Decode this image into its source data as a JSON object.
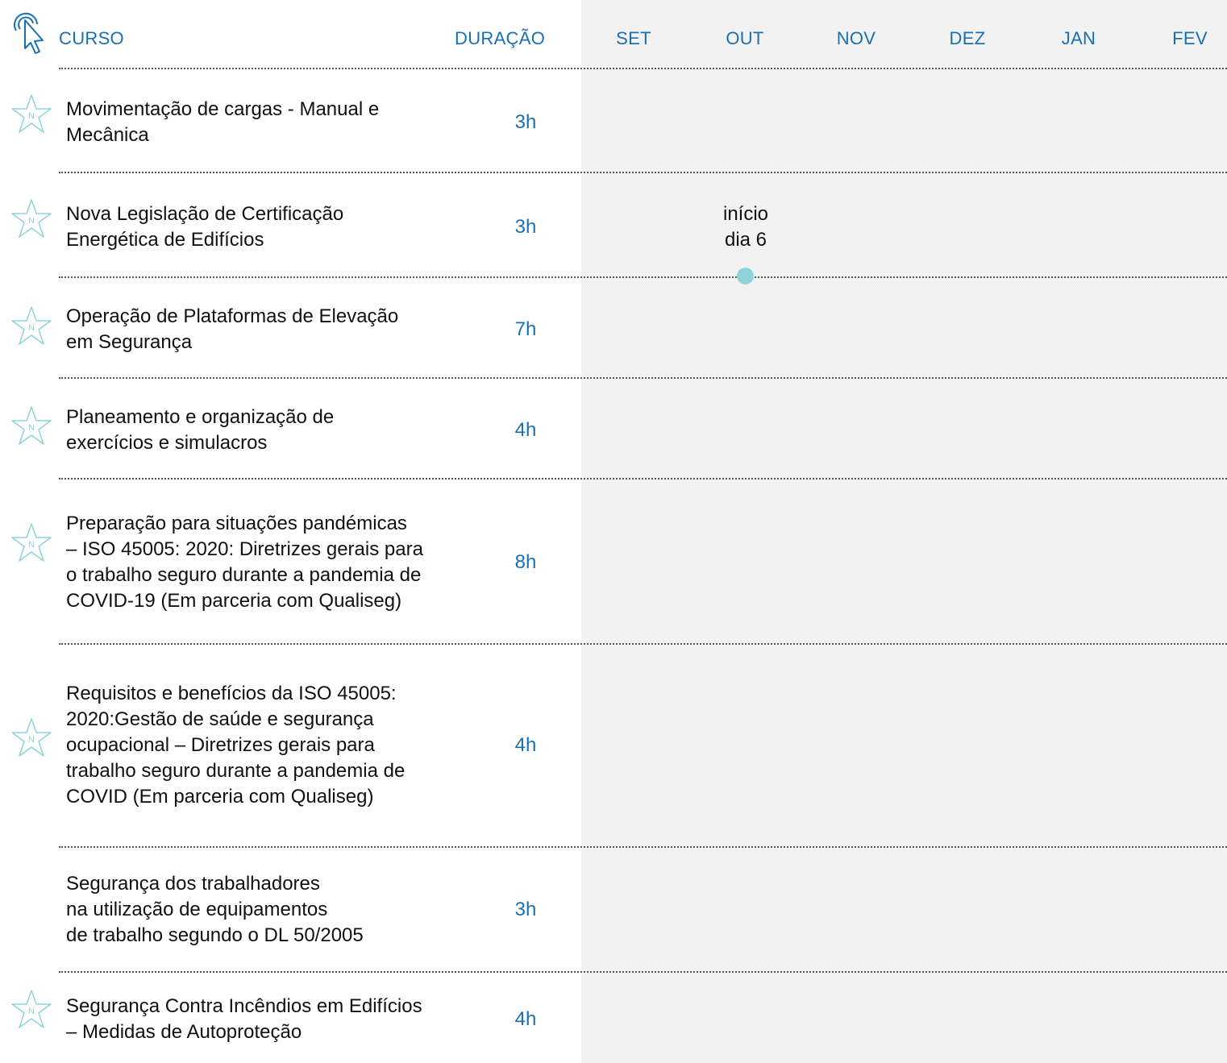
{
  "header": {
    "course_label": "CURSO",
    "duration_label": "DURAÇÃO",
    "months": [
      "SET",
      "OUT",
      "NOV",
      "DEZ",
      "JAN",
      "FEV"
    ]
  },
  "badge_letter": "N",
  "colors": {
    "accent": "#1a6fb3",
    "star": "#8fd3d8",
    "panel": "#f2f2f2",
    "dot": "#8fd3d8"
  },
  "courses": [
    {
      "title_lines": [
        "Movimentação de cargas - Manual e",
        "Mecânica"
      ],
      "duration": "3h",
      "new_badge": true
    },
    {
      "title_lines": [
        "Nova Legislação de Certificação",
        "Energética de Edifícios"
      ],
      "duration": "3h",
      "new_badge": true
    },
    {
      "title_lines": [
        "Operação de Plataformas de Elevação",
        "em Segurança"
      ],
      "duration": "7h",
      "new_badge": true
    },
    {
      "title_lines": [
        "Planeamento e organização de",
        "exercícios e simulacros"
      ],
      "duration": "4h",
      "new_badge": true
    },
    {
      "title_lines": [
        "Preparação para situações pandémicas",
        "– ISO 45005: 2020: Diretrizes gerais para",
        "o trabalho seguro durante a pandemia de",
        "COVID-19 (Em parceria com Qualiseg)"
      ],
      "duration": "8h",
      "new_badge": true
    },
    {
      "title_lines": [
        "Requisitos e benefícios da ISO 45005:",
        "2020:Gestão de saúde e segurança",
        "ocupacional – Diretrizes gerais para",
        "trabalho seguro durante a pandemia de",
        "COVID (Em parceria com Qualiseg)"
      ],
      "duration": "4h",
      "new_badge": true
    },
    {
      "title_lines": [
        "Segurança dos trabalhadores",
        "na utilização de equipamentos",
        "de trabalho segundo o DL 50/2005"
      ],
      "duration": "3h",
      "new_badge": false
    },
    {
      "title_lines": [
        "Segurança Contra Incêndios em Edifícios",
        "– Medidas de Autoproteção"
      ],
      "duration": "4h",
      "new_badge": true
    }
  ],
  "schedule_note": {
    "lines": [
      "início",
      "dia 6"
    ],
    "month": "OUT"
  }
}
